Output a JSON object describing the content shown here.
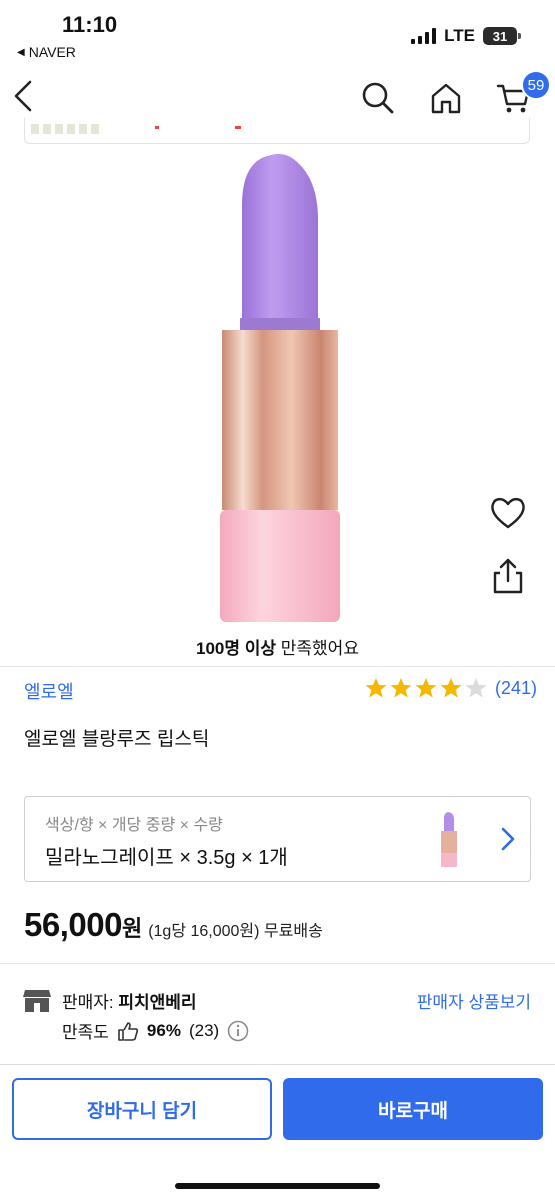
{
  "status_bar": {
    "time": "11:10",
    "back_app": "NAVER",
    "network": "LTE",
    "battery": "31"
  },
  "nav": {
    "cart_count": "59"
  },
  "product": {
    "satisfaction_bold": "100명 이상",
    "satisfaction_rest": " 만족했어요",
    "brand": "엘로엘",
    "rating": 4,
    "rating_count": "(241)",
    "name": "엘로엘 블랑루즈 립스틱"
  },
  "option": {
    "label": "색상/향 × 개당 중량 × 수량",
    "value": "밀라노그레이프 × 3.5g × 1개"
  },
  "price": {
    "amount": "56,000",
    "unit": "원",
    "detail": "(1g당 16,000원) 무료배송"
  },
  "seller": {
    "label": "판매자: ",
    "name": "피치앤베리",
    "link": "판매자 상품보기",
    "sat_label": "만족도",
    "sat_percent": "96%",
    "sat_count": "(23)"
  },
  "bottom": {
    "cart_button": "장바구니 담기",
    "buy_button": "바로구매"
  },
  "colors": {
    "accent": "#2f6bea",
    "star": "#f5b800",
    "lipstick": "#b48ee6",
    "case": "#f6b8c8"
  }
}
